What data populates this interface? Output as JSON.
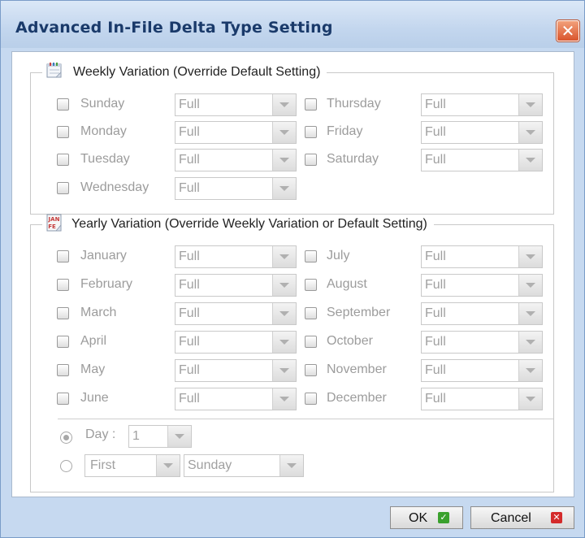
{
  "dialog": {
    "title": "Advanced In-File Delta Type Setting",
    "close_glyph": "✕"
  },
  "weekly": {
    "legend": "Weekly Variation (Override Default Setting)",
    "icon": "calendar-week-icon",
    "days": [
      {
        "label": "Sunday",
        "value": "Full"
      },
      {
        "label": "Monday",
        "value": "Full"
      },
      {
        "label": "Tuesday",
        "value": "Full"
      },
      {
        "label": "Wednesday",
        "value": "Full"
      },
      {
        "label": "Thursday",
        "value": "Full"
      },
      {
        "label": "Friday",
        "value": "Full"
      },
      {
        "label": "Saturday",
        "value": "Full"
      }
    ]
  },
  "yearly": {
    "legend": "Yearly Variation (Override Weekly Variation or Default Setting)",
    "icon": "calendar-month-icon",
    "icon_text": "JAN FEB",
    "months": [
      {
        "label": "January",
        "value": "Full"
      },
      {
        "label": "February",
        "value": "Full"
      },
      {
        "label": "March",
        "value": "Full"
      },
      {
        "label": "April",
        "value": "Full"
      },
      {
        "label": "May",
        "value": "Full"
      },
      {
        "label": "June",
        "value": "Full"
      },
      {
        "label": "July",
        "value": "Full"
      },
      {
        "label": "August",
        "value": "Full"
      },
      {
        "label": "September",
        "value": "Full"
      },
      {
        "label": "October",
        "value": "Full"
      },
      {
        "label": "November",
        "value": "Full"
      },
      {
        "label": "December",
        "value": "Full"
      }
    ],
    "day_option": {
      "label": "Day :",
      "value": "1",
      "selected": true
    },
    "weekday_option": {
      "ordinal": "First",
      "weekday": "Sunday",
      "selected": false
    }
  },
  "buttons": {
    "ok": "OK",
    "ok_icon": "check-icon",
    "cancel": "Cancel",
    "cancel_icon": "x-icon"
  },
  "colors": {
    "title_text": "#1a3a6a",
    "disabled_text": "#9c9c9c",
    "ok_icon": "#3aa12d",
    "cancel_icon": "#d42a2a",
    "close_button": "#d9552d"
  }
}
